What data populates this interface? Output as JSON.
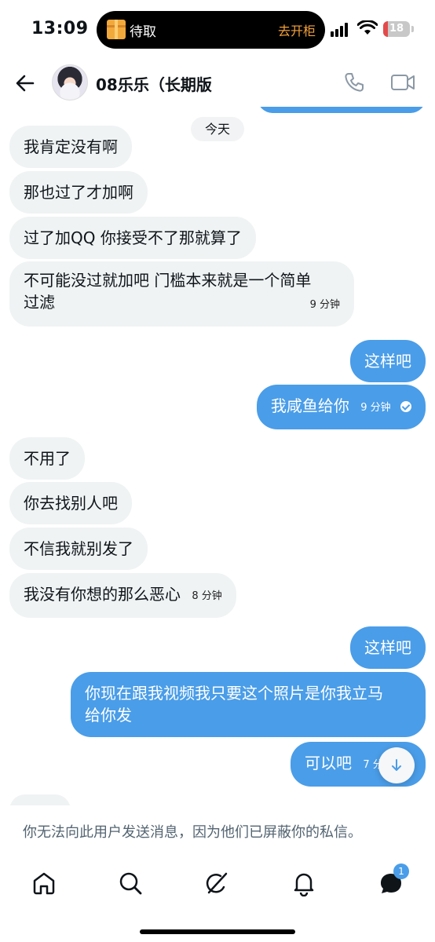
{
  "status_bar": {
    "time": "13:09",
    "island_left": "待取",
    "island_right": "去开柜",
    "battery": "18",
    "icons": [
      "package-icon",
      "signal-icon",
      "wifi-icon",
      "battery-icon"
    ]
  },
  "header": {
    "contact_name": "08乐乐（长期版",
    "icons": [
      "back-arrow-icon",
      "avatar",
      "phone-icon",
      "video-icon"
    ]
  },
  "chat": {
    "day_label": "今天",
    "messages": [
      {
        "side": "in",
        "text": "我肯定没有啊"
      },
      {
        "side": "in",
        "text": "那也过了才加啊"
      },
      {
        "side": "in",
        "text": "过了加QQ 你接受不了那就算了"
      },
      {
        "side": "in",
        "text_line1": "不可能没过就加吧 门槛本来就是一个简单",
        "text_line2": "过滤",
        "time": "9 分钟"
      },
      {
        "side": "out",
        "text": "这样吧"
      },
      {
        "side": "out",
        "text": "我咸鱼给你",
        "time": "9 分钟"
      },
      {
        "side": "in",
        "text": "不用了"
      },
      {
        "side": "in",
        "text": "你去找别人吧"
      },
      {
        "side": "in",
        "text": "不信我就别发了"
      },
      {
        "side": "in",
        "text": "我没有你想的那么恶心",
        "time": "8 分钟"
      },
      {
        "side": "out",
        "text": "这样吧"
      },
      {
        "side": "out",
        "text_line1": "你现在跟我视频我只要这个照片是你我立马",
        "text_line2": "给你发"
      },
      {
        "side": "out",
        "text": "可以吧",
        "time": "7 分钟"
      }
    ]
  },
  "notice": "你无法向此用户发送消息，因为他们已屏蔽你的私信。",
  "bottom_nav": {
    "items": [
      "home-icon",
      "search-icon",
      "grok-icon",
      "notifications-icon",
      "messages-icon"
    ],
    "messages_badge": "1"
  },
  "colors": {
    "outgoing_bubble": "#4a9de8",
    "incoming_bubble": "#eff3f4",
    "muted_text": "#536471"
  }
}
